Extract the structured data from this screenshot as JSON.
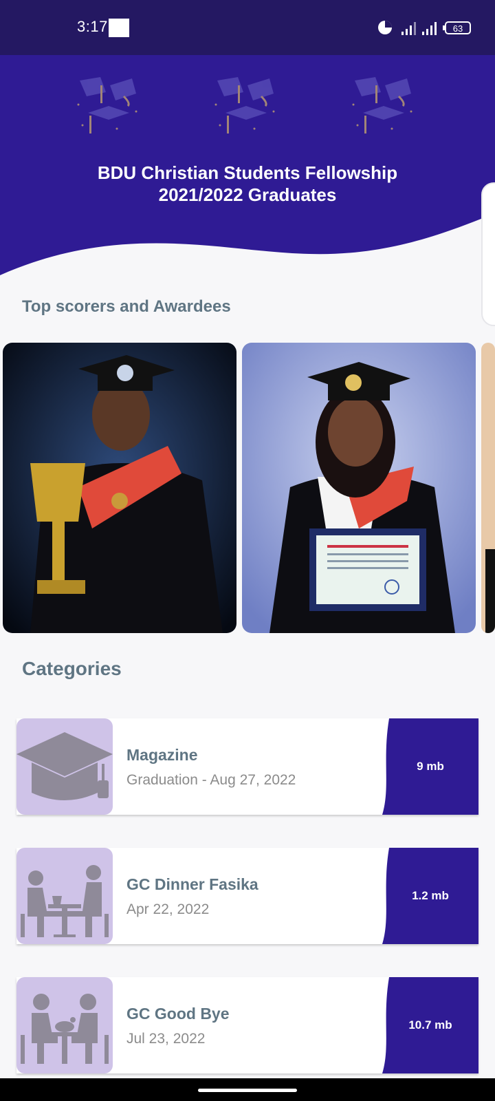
{
  "status_bar": {
    "time": "3:17",
    "battery": "63",
    "icons": [
      "pie-icon",
      "signal-icon",
      "signal-icon",
      "battery-icon"
    ]
  },
  "header": {
    "title_line1": "BDU Christian Students Fellowship",
    "title_line2": "2021/2022 Graduates",
    "decoration_icon": "graduation-caps-icon"
  },
  "awards_section": {
    "title": "Top scorers and Awardees",
    "photos": [
      {
        "name": "graduate-with-trophy"
      },
      {
        "name": "graduate-with-certificate"
      },
      {
        "name": "graduate-partial"
      }
    ]
  },
  "categories_section": {
    "title": "Categories",
    "items": [
      {
        "name": "Magazine",
        "date": "Graduation - Aug 27, 2022",
        "size": "9 mb",
        "icon": "graduation-cap-icon"
      },
      {
        "name": "GC Dinner Fasika",
        "date": "Apr 22, 2022",
        "size": "1.2 mb",
        "icon": "dinner-table-icon"
      },
      {
        "name": "GC Good Bye",
        "date": "Jul 23, 2022",
        "size": "10.7 mb",
        "icon": "dining-couple-icon"
      }
    ]
  },
  "colors": {
    "primary": "#2f1b94",
    "status_bar": "#241862",
    "thumb_bg": "#cfc3e8",
    "icon_gray": "#8f8a99",
    "section_title": "#5f7583"
  }
}
